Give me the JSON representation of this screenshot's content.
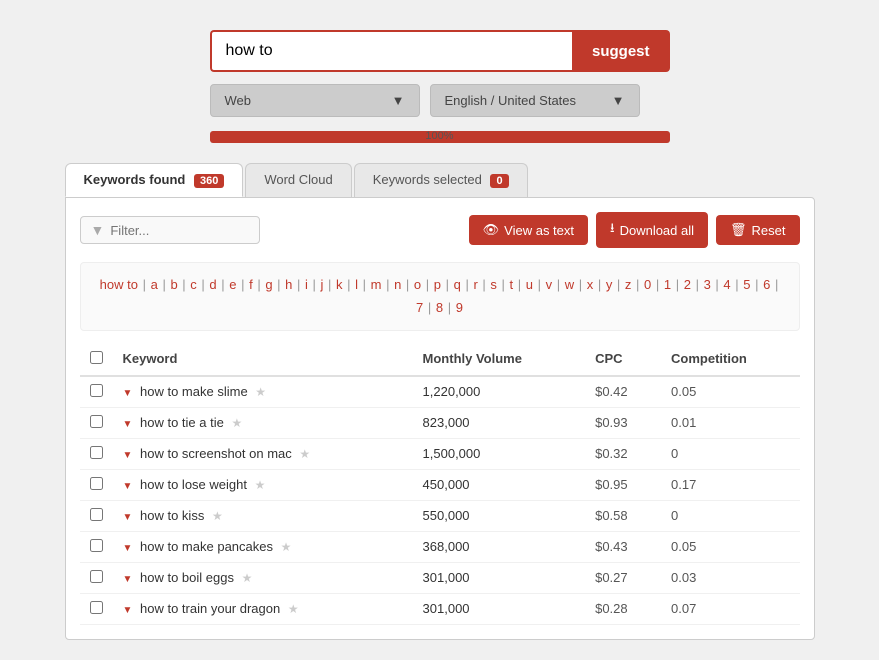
{
  "search": {
    "input_value": "how to",
    "suggest_label": "suggest",
    "placeholder": ""
  },
  "dropdowns": {
    "web_label": "Web",
    "language_label": "English / United States"
  },
  "progress": {
    "value": 100,
    "label": "100%"
  },
  "tabs": [
    {
      "id": "keywords-found",
      "label": "Keywords found",
      "badge": "360",
      "active": true
    },
    {
      "id": "word-cloud",
      "label": "Word Cloud",
      "badge": null,
      "active": false
    },
    {
      "id": "keywords-selected",
      "label": "Keywords selected",
      "badge": "0",
      "active": false
    }
  ],
  "toolbar": {
    "filter_placeholder": "Filter...",
    "view_as_text_label": "View as text",
    "download_all_label": "Download all",
    "reset_label": "Reset"
  },
  "alpha_nav": {
    "keyword": "how to",
    "letters": [
      "a",
      "b",
      "c",
      "d",
      "e",
      "f",
      "g",
      "h",
      "i",
      "j",
      "k",
      "l",
      "m",
      "n",
      "o",
      "p",
      "q",
      "r",
      "s",
      "t",
      "u",
      "v",
      "w",
      "x",
      "y",
      "z",
      "0",
      "1",
      "2",
      "3",
      "4",
      "5",
      "6",
      "7",
      "8",
      "9"
    ]
  },
  "table": {
    "columns": [
      "",
      "Keyword",
      "Monthly Volume",
      "CPC",
      "Competition"
    ],
    "rows": [
      {
        "keyword": "how to make slime",
        "volume": "1,220,000",
        "cpc": "$0.42",
        "competition": "0.05"
      },
      {
        "keyword": "how to tie a tie",
        "volume": "823,000",
        "cpc": "$0.93",
        "competition": "0.01"
      },
      {
        "keyword": "how to screenshot on mac",
        "volume": "1,500,000",
        "cpc": "$0.32",
        "competition": "0"
      },
      {
        "keyword": "how to lose weight",
        "volume": "450,000",
        "cpc": "$0.95",
        "competition": "0.17"
      },
      {
        "keyword": "how to kiss",
        "volume": "550,000",
        "cpc": "$0.58",
        "competition": "0"
      },
      {
        "keyword": "how to make pancakes",
        "volume": "368,000",
        "cpc": "$0.43",
        "competition": "0.05"
      },
      {
        "keyword": "how to boil eggs",
        "volume": "301,000",
        "cpc": "$0.27",
        "competition": "0.03"
      },
      {
        "keyword": "how to train your dragon",
        "volume": "301,000",
        "cpc": "$0.28",
        "competition": "0.07"
      }
    ]
  }
}
